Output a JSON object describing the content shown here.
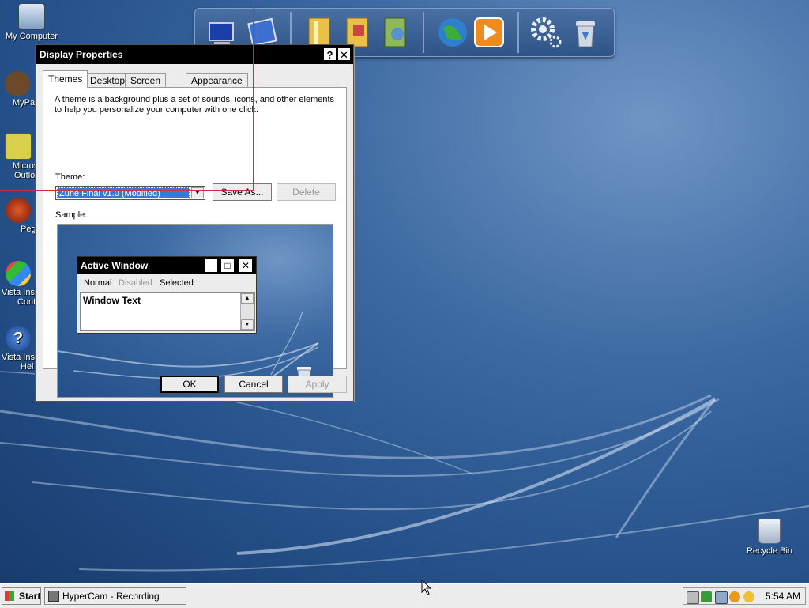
{
  "desktop": {
    "icons": [
      {
        "label": "My Computer"
      },
      {
        "label": "MyPa"
      },
      {
        "label": "Micros"
      },
      {
        "label": "Outlo"
      },
      {
        "label": "Peg"
      },
      {
        "label": "Vista Ins"
      },
      {
        "label": "Cont"
      },
      {
        "label": "Vista Ins"
      },
      {
        "label": "Hel"
      }
    ],
    "recycle_bin": "Recycle Bin"
  },
  "dock": {
    "icons": [
      "computer-icon",
      "network-icon",
      "documents-icon",
      "pictures-icon",
      "music-icon",
      "internet-icon",
      "media-player-icon",
      "settings-icon",
      "trash-icon"
    ]
  },
  "dialog": {
    "title": "Display Properties",
    "help_btn": "?",
    "close_btn": "✕",
    "tabs": [
      "Themes",
      "Desktop",
      "Screen Saver",
      "Appearance"
    ],
    "description": "A theme is a background plus a set of sounds, icons, and other elements to help you personalize your computer with one click.",
    "theme_label": "Theme:",
    "theme_value": "Zune Final v1.0 (Modified)",
    "save_as": "Save As...",
    "delete": "Delete",
    "sample_label": "Sample:",
    "sample": {
      "window_title": "Active Window",
      "menu": [
        "Normal",
        "Disabled",
        "Selected"
      ],
      "window_text": "Window Text"
    },
    "ok": "OK",
    "cancel": "Cancel",
    "apply": "Apply"
  },
  "taskbar": {
    "start": "Start",
    "task": "HyperCam - Recording",
    "clock": "5:54 AM"
  },
  "colors": {
    "titlebar": "#000000",
    "selection": "#3a79d0",
    "desktop": "#2a5590"
  }
}
